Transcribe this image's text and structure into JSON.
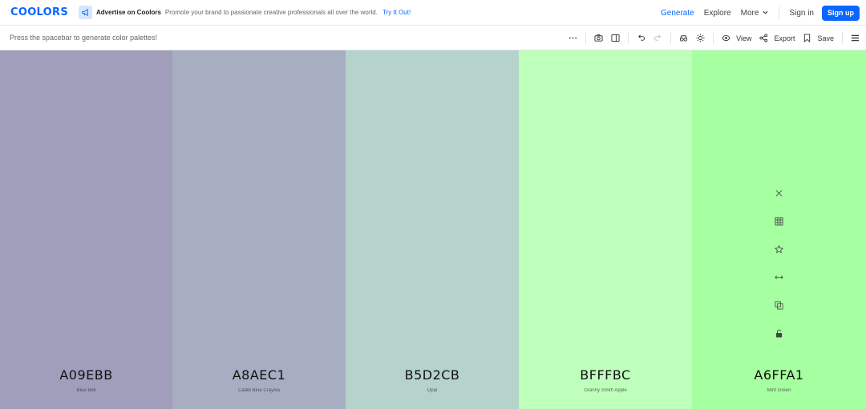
{
  "header": {
    "logo": "coolors",
    "ad_title": "Advertise on Coolors",
    "ad_text": "Promote your brand to passionate creative professionals all over the world.",
    "ad_cta": "Try It Out!",
    "nav": [
      {
        "label": "Generate",
        "active": true
      },
      {
        "label": "Explore"
      },
      {
        "label": "More"
      }
    ],
    "signin": "Sign in",
    "signup": "Sign up",
    "accent": "#0a66ff"
  },
  "toolbar": {
    "hint": "Press the spacebar to generate color palettes!",
    "view": "View",
    "export": "Export",
    "save": "Save"
  },
  "palette": [
    {
      "hex": "A09EBB",
      "name": "Blue Bell",
      "color": "#A09EBB"
    },
    {
      "hex": "A8AEC1",
      "name": "Cadet Blue Crayola",
      "color": "#A8AEC1"
    },
    {
      "hex": "B5D2CB",
      "name": "Opal",
      "color": "#B5D2CB"
    },
    {
      "hex": "BFFFBC",
      "name": "Granny Smith Apple",
      "color": "#BFFFBC"
    },
    {
      "hex": "A6FFA1",
      "name": "Mint Green",
      "color": "#A6FFA1"
    }
  ]
}
